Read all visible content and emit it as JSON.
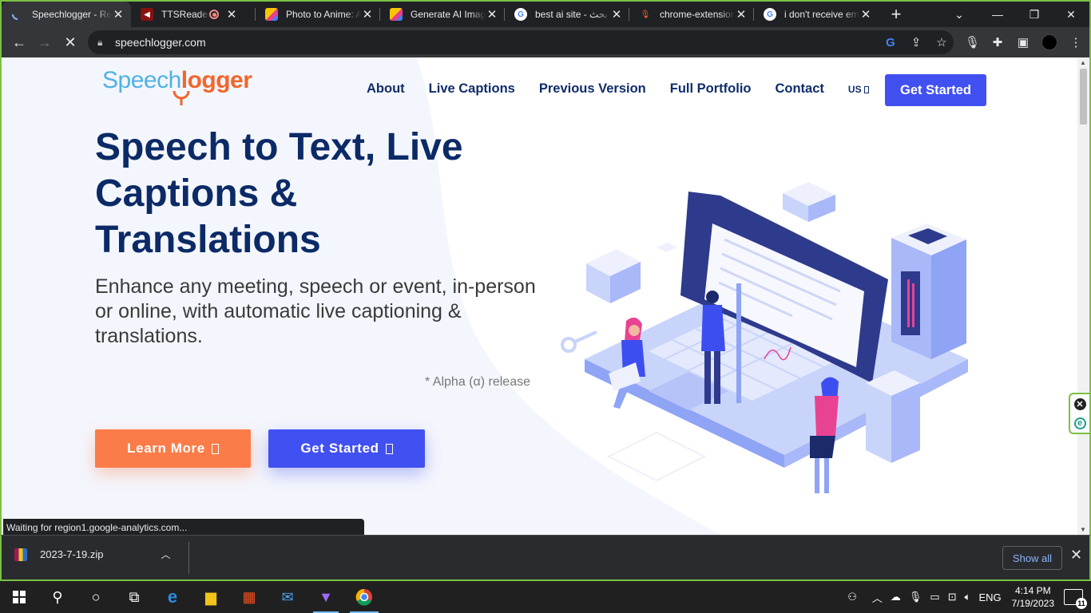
{
  "browser": {
    "tabs": [
      {
        "title": "Speechlogger - Real-time",
        "active": true,
        "icon": "loading-spinner-icon"
      },
      {
        "title": "TTSReader's Text to Speech",
        "active": false,
        "icon": "ttsreader-icon",
        "recording": true
      },
      {
        "title": "Photo to Anime: Ai Anime",
        "active": false,
        "icon": "photo-anime-icon"
      },
      {
        "title": "Generate AI Images",
        "active": false,
        "icon": "generate-ai-icon"
      },
      {
        "title": "best ai site - بحث Google",
        "active": false,
        "icon": "google-icon"
      },
      {
        "title": "chrome-extension",
        "active": false,
        "icon": "mic-icon"
      },
      {
        "title": "i don't receive email",
        "active": false,
        "icon": "google-icon"
      }
    ],
    "url": "speechlogger.com",
    "status_text": "Waiting for region1.google-analytics.com..."
  },
  "site": {
    "logo_part1": "Speech",
    "logo_part2": "logger",
    "nav": [
      "About",
      "Live Captions",
      "Previous Version",
      "Full Portfolio",
      "Contact"
    ],
    "language": "US",
    "cta_top": "Get Started",
    "hero_title": "Speech to Text, Live Captions & Translations",
    "hero_subtitle": "Enhance any meeting, speech or event, in-person or online, with automatic live captioning & translations.",
    "alpha_note": "* Alpha (α) release",
    "learn_more": "Learn More",
    "get_started": "Get Started"
  },
  "downloads": {
    "file": "2023-7-19.zip",
    "show_all": "Show all"
  },
  "taskbar": {
    "time": "4:14 PM",
    "date": "7/19/2023",
    "lang": "ENG",
    "notification_count": "11"
  },
  "colors": {
    "accent_blue": "#4150f1",
    "accent_orange": "#fb7c48",
    "heading_navy": "#0b2a66",
    "window_border": "#7ac143"
  }
}
